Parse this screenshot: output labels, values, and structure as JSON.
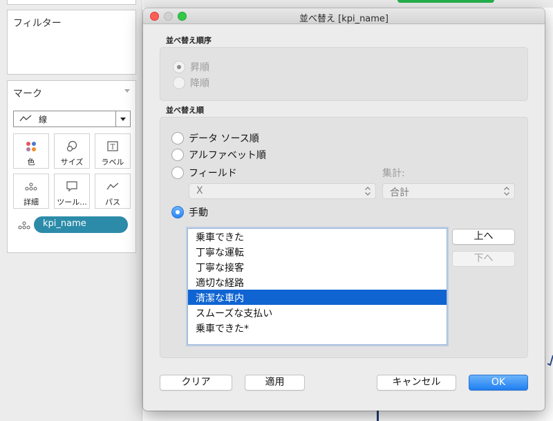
{
  "background": {
    "filters_title": "フィルター",
    "marks_title": "マーク",
    "mark_type": "線",
    "mark_buttons": [
      {
        "label": "色",
        "icon": "color-dots-icon"
      },
      {
        "label": "サイズ",
        "icon": "size-circles-icon"
      },
      {
        "label": "ラベル",
        "icon": "label-t-icon"
      },
      {
        "label": "詳細",
        "icon": "detail-dots-icon"
      },
      {
        "label": "ツール...",
        "icon": "tooltip-bubble-icon"
      },
      {
        "label": "パス",
        "icon": "path-line-icon"
      }
    ],
    "field_pill": "kpi_name"
  },
  "dialog": {
    "title": "並べ替え [kpi_name]",
    "sort_order": {
      "label": "並べ替え順序",
      "options": [
        "昇順",
        "降順"
      ],
      "selected": "昇順",
      "enabled": false
    },
    "sort_by": {
      "label": "並べ替え順",
      "options": [
        "データ ソース順",
        "アルファベット順",
        "フィールド",
        "手動"
      ],
      "selected": "手動",
      "field_value": "X",
      "aggregation_label": "集計:",
      "aggregation_value": "合計"
    },
    "manual_list": {
      "items": [
        "乗車できた",
        "丁寧な運転",
        "丁寧な接客",
        "適切な経路",
        "清潔な車内",
        "スムーズな支払い",
        "乗車できた*"
      ],
      "selected_index": 4
    },
    "buttons": {
      "up": "上へ",
      "down": "下へ",
      "clear": "クリア",
      "apply": "適用",
      "cancel": "キャンセル",
      "ok": "OK"
    }
  },
  "colors": {
    "pill": "#2c8ba9",
    "selection": "#0f64d2",
    "accent_blue": "#2a86f3"
  }
}
